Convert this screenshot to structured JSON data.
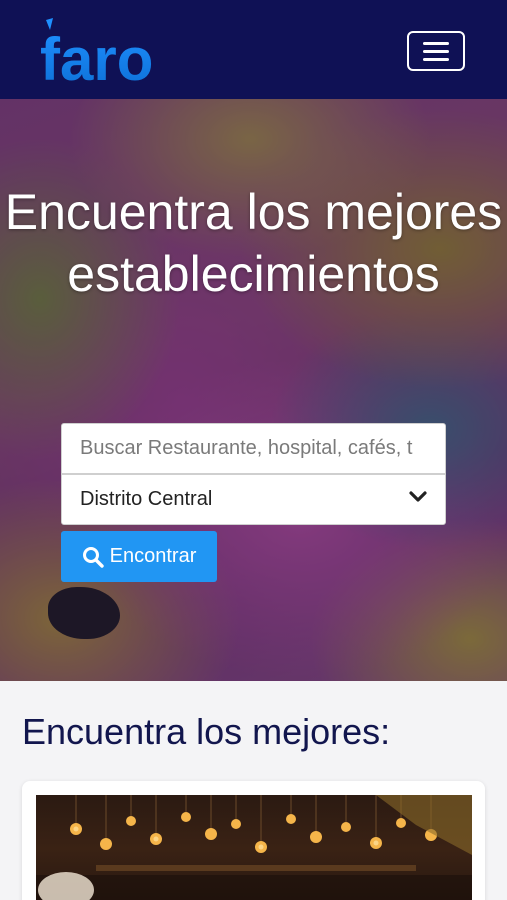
{
  "brand": {
    "logo_text": "faro",
    "accent": "#2196f3",
    "nav_bg": "#0f1155"
  },
  "nav": {
    "menu_icon": "hamburger-menu-icon"
  },
  "hero": {
    "title": "Encuentra los mejores establecimientos",
    "search": {
      "placeholder": "Buscar Restaurante, hospital, cafés, t",
      "value": ""
    },
    "district": {
      "selected": "Distrito Central",
      "icon": "chevron-down-icon"
    },
    "find_button": {
      "label": "Encontrar",
      "icon": "search-icon"
    }
  },
  "section": {
    "title": "Encuentra los mejores:"
  },
  "cards": [
    {
      "image": "restaurant-interior-photo"
    }
  ]
}
